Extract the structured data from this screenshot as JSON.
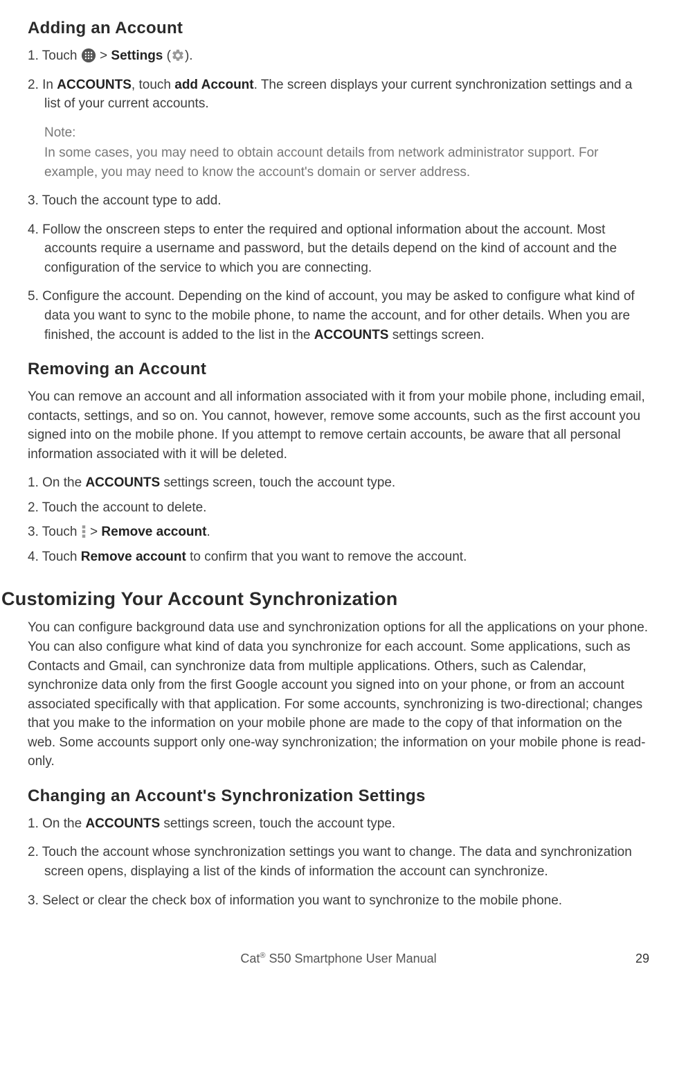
{
  "adding": {
    "title": "Adding an Account",
    "step1_a": "1. Touch ",
    "step1_b": " > ",
    "step1_settings": "Settings",
    "step1_c": " (",
    "step1_d": ").",
    "step2_a": "2. In ",
    "step2_accounts": "ACCOUNTS",
    "step2_b": ", touch ",
    "step2_add": "add Account",
    "step2_c": ". The screen displays your current synchronization settings and a list of your current accounts.",
    "note_label": "Note:",
    "note_body": "In some cases, you may need to obtain account details from network administrator support. For example, you may need to know the account's domain or server address.",
    "step3": "3. Touch the account type to add.",
    "step4": "4. Follow the onscreen steps to enter the required and optional information about the account. Most accounts require a username and password, but the details depend on the kind of account and the configuration of the service to which you are connecting.",
    "step5_a": "5. Configure the account. Depending on the kind of account, you may be asked to configure what kind of data you want to sync to the mobile phone, to name the account, and for other details. When you are finished, the account is added to the list in the ",
    "step5_accounts": "ACCOUNTS",
    "step5_b": " settings screen."
  },
  "removing": {
    "title": "Removing an Account",
    "intro": "You can remove an account and all information associated with it from your mobile phone, including email, contacts, settings, and so on. You cannot, however, remove some accounts, such as the first account you signed into on the mobile phone. If you attempt to remove certain accounts, be aware that all personal information associated with it will be deleted.",
    "step1_a": "1. On the ",
    "step1_accounts": "ACCOUNTS",
    "step1_b": " settings screen, touch the account type.",
    "step2": "2. Touch the account to delete.",
    "step3_a": "3. Touch ",
    "step3_b": " > ",
    "step3_remove": "Remove account",
    "step3_c": ".",
    "step4_a": "4. Touch ",
    "step4_remove": "Remove account",
    "step4_b": " to confirm that you want to remove the account."
  },
  "customizing": {
    "title": "Customizing Your Account Synchronization",
    "intro": "You can configure background data use and synchronization options for all the applications on your phone. You can also configure what kind of data you synchronize for each account. Some applications, such as Contacts and Gmail, can synchronize data from multiple applications. Others, such as Calendar, synchronize data only from the first Google account you signed into on your phone, or from an account associated specifically with that application. For some accounts, synchronizing is two-directional; changes that you make to the information on your mobile phone are made to the copy of that information on the web. Some accounts support only one-way synchronization; the information on your mobile phone is read-only."
  },
  "changing": {
    "title": "Changing an Account's Synchronization Settings",
    "step1_a": "1. On the ",
    "step1_accounts": "ACCOUNTS",
    "step1_b": " settings screen, touch the account type.",
    "step2": "2. Touch the account whose synchronization settings you want to change. The data and synchronization screen opens, displaying a list of the kinds of information the account can synchronize.",
    "step3": "3. Select or clear the check box of information you want to synchronize to the mobile phone."
  },
  "footer": {
    "title_a": "Cat",
    "title_b": " S50 Smartphone User Manual",
    "reg": "®",
    "page": "29"
  }
}
